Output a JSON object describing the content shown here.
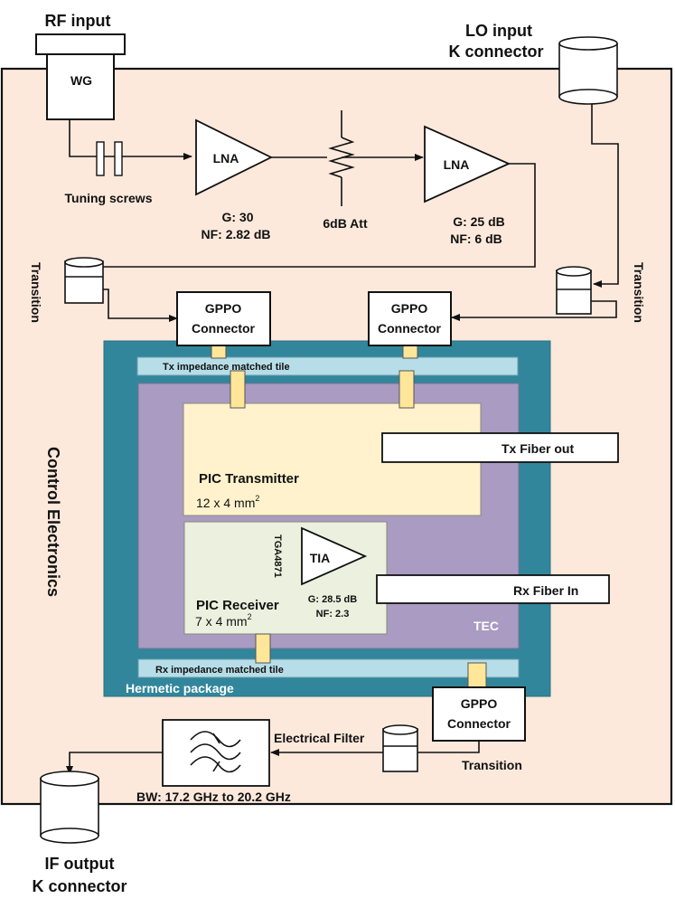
{
  "colors": {
    "enclosure_bg": "#fce9dc",
    "hermetic": "#31869b",
    "tile": "#b7dde8",
    "tec": "#a99bc2",
    "pic_tx": "#fff2cc",
    "pic_rx": "#ebf1de",
    "pad": "#ffe699"
  },
  "labels": {
    "rf_input": "RF input",
    "wg": "WG",
    "lo_input_line1": "LO input",
    "lo_input_line2": "K connector",
    "tuning_screws": "Tuning screws",
    "lna1": "LNA",
    "lna1_gain": "G: 30",
    "lna1_nf": "NF: 2.82 dB",
    "attenuator": "6dB Att",
    "lna2": "LNA",
    "lna2_gain": "G: 25 dB",
    "lna2_nf": "NF: 6 dB",
    "transition_left": "Transition",
    "transition_right": "Transition",
    "transition_bottom": "Transition",
    "gppo_line1": "GPPO",
    "gppo_line2": "Connector",
    "tx_tile": "Tx impedance matched tile",
    "rx_tile": "Rx impedance matched tile",
    "tx_fiber": "Tx Fiber out",
    "rx_fiber": "Rx Fiber In",
    "pic_tx": "PIC Transmitter",
    "pic_tx_size": "12 x 4 mm",
    "pic_rx": "PIC Receiver",
    "pic_rx_size": "7 x 4 mm",
    "size_exp": "2",
    "tia": "TIA",
    "tia_part": "TGA4871",
    "tia_gain": "G: 28.5 dB",
    "tia_nf": "NF: 2.3",
    "tec": "TEC",
    "hermetic": "Hermetic package",
    "control": "Control Electronics",
    "filter": "Electrical Filter",
    "filter_bw": "BW: 17.2 GHz to 20.2 GHz",
    "if_line1": "IF output",
    "if_line2": "K connector"
  }
}
